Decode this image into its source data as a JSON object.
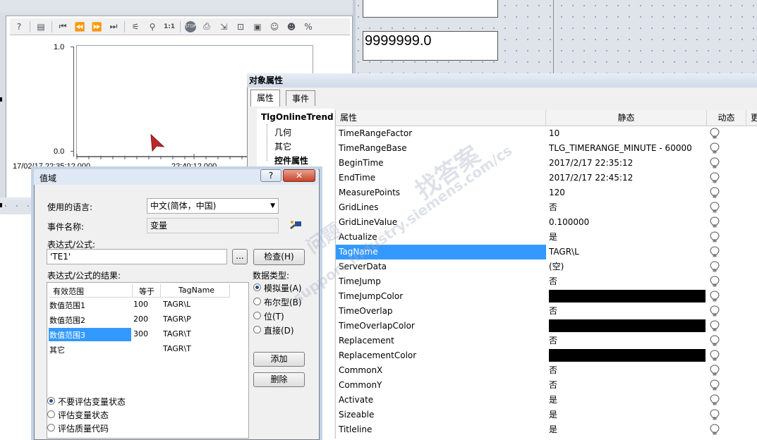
{
  "trend": {
    "y_max": "1.0",
    "y_min": "0.0",
    "x_start": "17/02/17  22:35:12.000",
    "x_end": "22:40:12.000",
    "toolbar_icons": [
      "help-icon",
      "config-icon",
      "first-icon",
      "prev-fast-icon",
      "next-fast-icon",
      "last-icon",
      "ruler-icon",
      "zoom-icon",
      "one-to-one-icon",
      "stop-icon",
      "print-icon",
      "export-icon",
      "axis-icon",
      "save-icon",
      "user-icon",
      "user2-icon",
      "percent-icon"
    ],
    "toolbar_glyphs": {
      "one_to_one": "1:1",
      "percent": "%",
      "stop": "STOP"
    }
  },
  "value_box": {
    "value": "9999999.0"
  },
  "props_panel": {
    "title": "对象属性",
    "tabs": [
      "属性",
      "事件"
    ],
    "tree": {
      "root": "TlgOnlineTrend",
      "items": [
        "几何",
        "其它",
        "控件属性"
      ]
    },
    "columns": [
      "属性",
      "静态",
      "动态",
      "更"
    ],
    "rows": [
      {
        "name": "TimeRangeFactor",
        "value": "10"
      },
      {
        "name": "TimeRangeBase",
        "value": "TLG_TIMERANGE_MINUTE - 60000"
      },
      {
        "name": "BeginTime",
        "value": "2017/2/17 22:35:12"
      },
      {
        "name": "EndTime",
        "value": "2017/2/17 22:45:12"
      },
      {
        "name": "MeasurePoints",
        "value": "120"
      },
      {
        "name": "GridLines",
        "value": "否"
      },
      {
        "name": "GridLineValue",
        "value": "0.100000"
      },
      {
        "name": "Actualize",
        "value": "是"
      },
      {
        "name": "TagName",
        "value": "TAGR\\L",
        "selected": true
      },
      {
        "name": "ServerData",
        "value": "(空)"
      },
      {
        "name": "TimeJump",
        "value": "否"
      },
      {
        "name": "TimeJumpColor",
        "value": "",
        "color": "#000000"
      },
      {
        "name": "TimeOverlap",
        "value": "否"
      },
      {
        "name": "TimeOverlapColor",
        "value": "",
        "color": "#000000"
      },
      {
        "name": "Replacement",
        "value": "否"
      },
      {
        "name": "ReplacementColor",
        "value": "",
        "color": "#000000"
      },
      {
        "name": "CommonX",
        "value": "否"
      },
      {
        "name": "CommonY",
        "value": "否"
      },
      {
        "name": "Activate",
        "value": "是"
      },
      {
        "name": "Sizeable",
        "value": "是"
      },
      {
        "name": "Titleline",
        "value": "是"
      }
    ]
  },
  "dialog": {
    "title": "值域",
    "help_label": "?",
    "close_label": "✕",
    "language_label": "使用的语言:",
    "language_value": "中文(简体，中国)",
    "event_label": "事件名称:",
    "event_value": "变量",
    "expr_label": "表达式/公式:",
    "expr_value": "'TE1'",
    "browse_label": "...",
    "check_label": "检查(H)",
    "result_label": "表达式/公式的结果:",
    "list_headers": [
      "有效范围",
      "等于",
      "TagName"
    ],
    "list_rows": [
      {
        "range": "数值范围1",
        "eq": "100",
        "tag": "TAGR\\L"
      },
      {
        "range": "数值范围2",
        "eq": "200",
        "tag": "TAGR\\P"
      },
      {
        "range": "数值范围3",
        "eq": "300",
        "tag": "TAGR\\T",
        "selected": true
      },
      {
        "range": "其它",
        "eq": "",
        "tag": "TAGR\\T"
      }
    ],
    "datatype_label": "数据类型:",
    "datatypes": [
      {
        "label": "模拟量(A)",
        "checked": true
      },
      {
        "label": "布尔型(B)",
        "checked": false
      },
      {
        "label": "位(T)",
        "checked": false
      },
      {
        "label": "直接(D)",
        "checked": false
      }
    ],
    "add_label": "添加",
    "delete_label": "删除",
    "eval_options": [
      {
        "label": "不要评估变量状态",
        "checked": true
      },
      {
        "label": "评估变量状态",
        "checked": false
      },
      {
        "label": "评估质量代码",
        "checked": false
      }
    ]
  },
  "watermark": {
    "text1": "找答案",
    "text2": "support.industry.siemens.com/cs",
    "text3": "问题"
  },
  "colors": {
    "selection": "#3399ff",
    "cursor_marker": "#c0272d"
  }
}
